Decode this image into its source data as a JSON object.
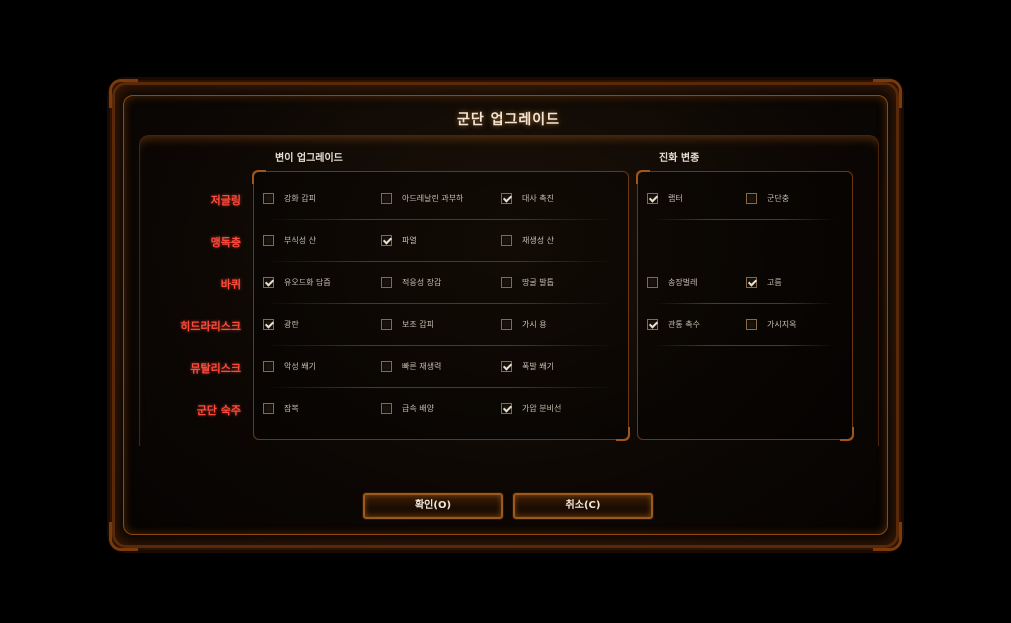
{
  "dialog": {
    "title": "군단 업그레이드",
    "mutation_header": "변이 업그레이드",
    "evolution_header": "진화 변종",
    "rows": [
      {
        "label": "저글링",
        "mutations": [
          {
            "label": "강화 갑피",
            "checked": false
          },
          {
            "label": "아드레날린 과부하",
            "checked": false
          },
          {
            "label": "대사 촉진",
            "checked": true
          }
        ],
        "evolutions": [
          {
            "label": "랩터",
            "checked": true
          },
          {
            "label": "군단충",
            "checked": false
          }
        ]
      },
      {
        "label": "맹독충",
        "mutations": [
          {
            "label": "부식성 산",
            "checked": false
          },
          {
            "label": "파열",
            "checked": true
          },
          {
            "label": "재생성 산",
            "checked": false
          }
        ],
        "evolutions": []
      },
      {
        "label": "바퀴",
        "mutations": [
          {
            "label": "유오드화 담즙",
            "checked": true
          },
          {
            "label": "적응성 장갑",
            "checked": false
          },
          {
            "label": "땅굴 발톱",
            "checked": false
          }
        ],
        "evolutions": [
          {
            "label": "송장벌레",
            "checked": false
          },
          {
            "label": "고름",
            "checked": true
          }
        ]
      },
      {
        "label": "히드라리스크",
        "mutations": [
          {
            "label": "광란",
            "checked": true
          },
          {
            "label": "보조 갑피",
            "checked": false
          },
          {
            "label": "가시 용",
            "checked": false
          }
        ],
        "evolutions": [
          {
            "label": "관통 촉수",
            "checked": true
          },
          {
            "label": "가시지옥",
            "checked": false
          }
        ]
      },
      {
        "label": "뮤탈리스크",
        "mutations": [
          {
            "label": "악성 쐐기",
            "checked": false
          },
          {
            "label": "빠른 재생력",
            "checked": false
          },
          {
            "label": "폭발 쐐기",
            "checked": true
          }
        ],
        "evolutions": []
      },
      {
        "label": "군단 숙주",
        "mutations": [
          {
            "label": "잠복",
            "checked": false
          },
          {
            "label": "급속 배양",
            "checked": false
          },
          {
            "label": "가압 분비선",
            "checked": true
          }
        ],
        "evolutions": []
      }
    ],
    "ok_label": "확인(O)",
    "cancel_label": "취소(C)"
  }
}
